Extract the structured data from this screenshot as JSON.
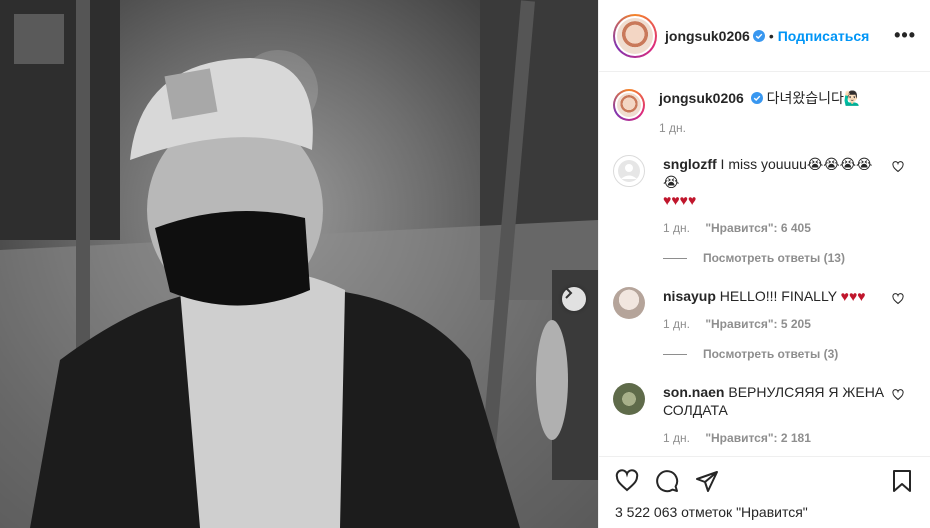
{
  "header": {
    "username": "jongsuk0206",
    "dot": "•",
    "follow_label": "Подписаться",
    "more_label": "•••"
  },
  "caption": {
    "username": "jongsuk0206",
    "text": "다녀왔습니다🙋🏻‍♂️",
    "time": "1 дн."
  },
  "comments": [
    {
      "username": "snglozff",
      "text_line1": "I miss youuuu😭😭😭😭😭",
      "text_line2": "♥♥♥♥",
      "time": "1 дн.",
      "likes": "\"Нравится\": 6 405",
      "replies": "Посмотреть ответы (13)"
    },
    {
      "username": "nisayup",
      "text": "HELLO!!! FINALLY",
      "hearts": "♥♥♥",
      "time": "1 дн.",
      "likes": "\"Нравится\": 5 205",
      "replies": "Посмотреть ответы (3)"
    },
    {
      "username": "son.naen",
      "text": "ВЕРНУЛСЯЯЯ Я ЖЕНА СОЛДАТА",
      "time": "1 дн.",
      "likes": "\"Нравится\": 2 181"
    }
  ],
  "footer": {
    "likes_text": "3 522 063 отметок \"Нравится\""
  },
  "colors": {
    "accent": "#0095f6",
    "text": "#262626",
    "muted": "#8e8e8e",
    "heart_red": "#c0162c"
  },
  "icons": [
    "verified-badge-icon",
    "more-options-icon",
    "heart-icon",
    "comment-icon",
    "share-icon",
    "bookmark-icon",
    "next-arrow-icon"
  ]
}
